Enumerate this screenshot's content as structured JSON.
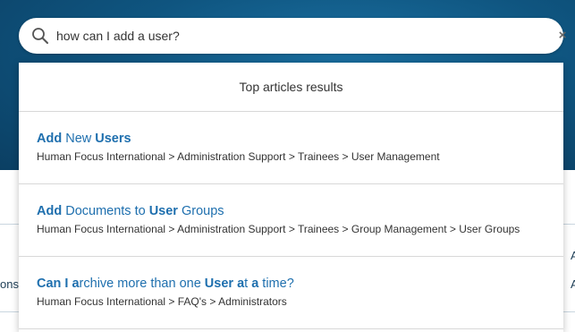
{
  "search": {
    "value": "how can I add a user?",
    "clear_label": "×"
  },
  "results": {
    "header": "Top articles results",
    "items": [
      {
        "title_parts": [
          {
            "text": "Add",
            "bold": true
          },
          {
            "text": " New ",
            "bold": false
          },
          {
            "text": "Users",
            "bold": true
          }
        ],
        "path": "Human Focus International > Administration Support > Trainees > User Management"
      },
      {
        "title_parts": [
          {
            "text": "Add",
            "bold": true
          },
          {
            "text": " Documents to ",
            "bold": false
          },
          {
            "text": "User",
            "bold": true
          },
          {
            "text": " Groups",
            "bold": false
          }
        ],
        "path": "Human Focus International > Administration Support > Trainees > Group Management > User Groups"
      },
      {
        "title_parts": [
          {
            "text": "Can I a",
            "bold": true
          },
          {
            "text": "rchive more than one ",
            "bold": false
          },
          {
            "text": "User a",
            "bold": true
          },
          {
            "text": "t ",
            "bold": false
          },
          {
            "text": "a",
            "bold": true
          },
          {
            "text": " time?",
            "bold": false
          }
        ],
        "path": "Human Focus International > FAQ's > Administrators"
      }
    ]
  },
  "background": {
    "left_fragment": "ons",
    "right_fragment_1": "A",
    "right_fragment_2": "A"
  },
  "colors": {
    "hero": "#0f5580",
    "link": "#1e6fae"
  }
}
